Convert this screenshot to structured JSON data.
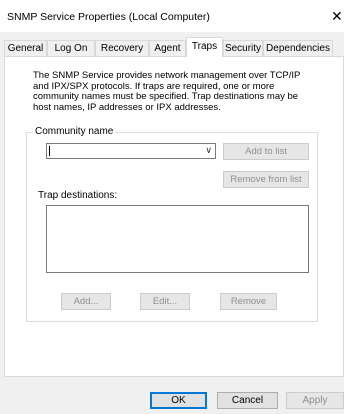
{
  "window": {
    "title": "SNMP Service Properties (Local Computer)",
    "close_glyph": "✕"
  },
  "tabs": [
    {
      "label": "General"
    },
    {
      "label": "Log On"
    },
    {
      "label": "Recovery"
    },
    {
      "label": "Agent"
    },
    {
      "label": "Traps"
    },
    {
      "label": "Security"
    },
    {
      "label": "Dependencies"
    }
  ],
  "active_tab": "Traps",
  "description": "The SNMP Service provides network management over TCP/IP and IPX/SPX protocols. If traps are required, one or more community names must be specified. Trap destinations may be host names, IP addresses or IPX addresses.",
  "community": {
    "label": "Community name",
    "value": "",
    "add_to_list": "Add to list",
    "remove_from_list": "Remove from list"
  },
  "trap_destinations": {
    "label": "Trap destinations:",
    "items": [],
    "add": "Add...",
    "edit": "Edit...",
    "remove": "Remove"
  },
  "footer": {
    "ok": "OK",
    "cancel": "Cancel",
    "apply": "Apply"
  },
  "icons": {
    "dropdown": "chevron-down-icon",
    "close": "close-icon"
  }
}
